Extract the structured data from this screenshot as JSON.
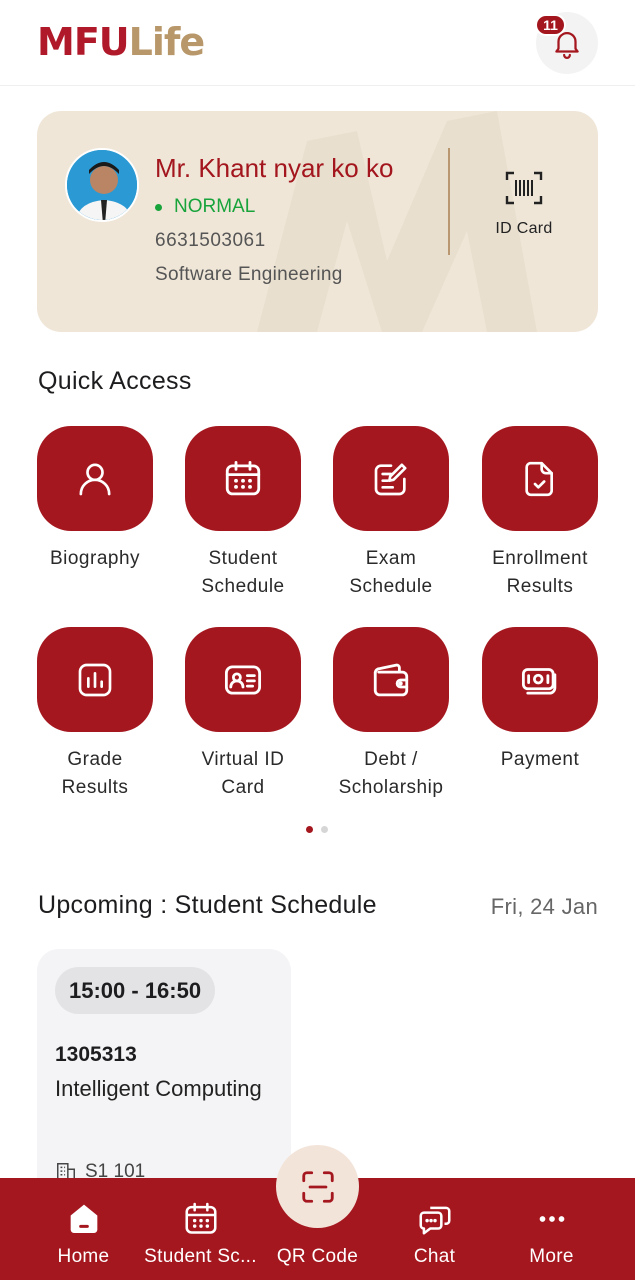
{
  "header": {
    "logo_part1": "MFU",
    "logo_part2": "Life",
    "notification_count": "11"
  },
  "profile": {
    "name": "Mr. Khant nyar ko ko",
    "status": "NORMAL",
    "student_id": "6631503061",
    "major": "Software Engineering",
    "id_card_label": "ID Card"
  },
  "quick_access": {
    "title": "Quick Access",
    "items": [
      {
        "label1": "Biography",
        "label2": "",
        "icon": "user-icon"
      },
      {
        "label1": "Student",
        "label2": "Schedule",
        "icon": "calendar-icon"
      },
      {
        "label1": "Exam",
        "label2": "Schedule",
        "icon": "edit-note-icon"
      },
      {
        "label1": "Enrollment",
        "label2": "Results",
        "icon": "document-check-icon"
      },
      {
        "label1": "Grade",
        "label2": "Results",
        "icon": "bar-chart-icon"
      },
      {
        "label1": "Virtual ID",
        "label2": "Card",
        "icon": "id-card-icon"
      },
      {
        "label1": "Debt /",
        "label2": "Scholarship",
        "icon": "wallet-icon"
      },
      {
        "label1": "Payment",
        "label2": "",
        "icon": "money-icon"
      }
    ],
    "pages": 2,
    "active_page": 1
  },
  "upcoming": {
    "title": "Upcoming : Student Schedule",
    "date": "Fri, 24 Jan",
    "card": {
      "time": "15:00 - 16:50",
      "course_code": "1305313",
      "course_name": "Intelligent Computing",
      "room": "S1 101"
    }
  },
  "bottom_nav": {
    "items": [
      {
        "label": "Home",
        "icon": "home-icon"
      },
      {
        "label": "Student Sc...",
        "icon": "calendar-icon"
      },
      {
        "label": "QR Code",
        "icon": "qr-scan-icon"
      },
      {
        "label": "Chat",
        "icon": "chat-icon"
      },
      {
        "label": "More",
        "icon": "more-icon"
      }
    ]
  },
  "colors": {
    "brand_red": "#a5171f",
    "brand_gold": "#b8976a",
    "card_beige": "#efe6d8",
    "status_green": "#18a33b"
  }
}
